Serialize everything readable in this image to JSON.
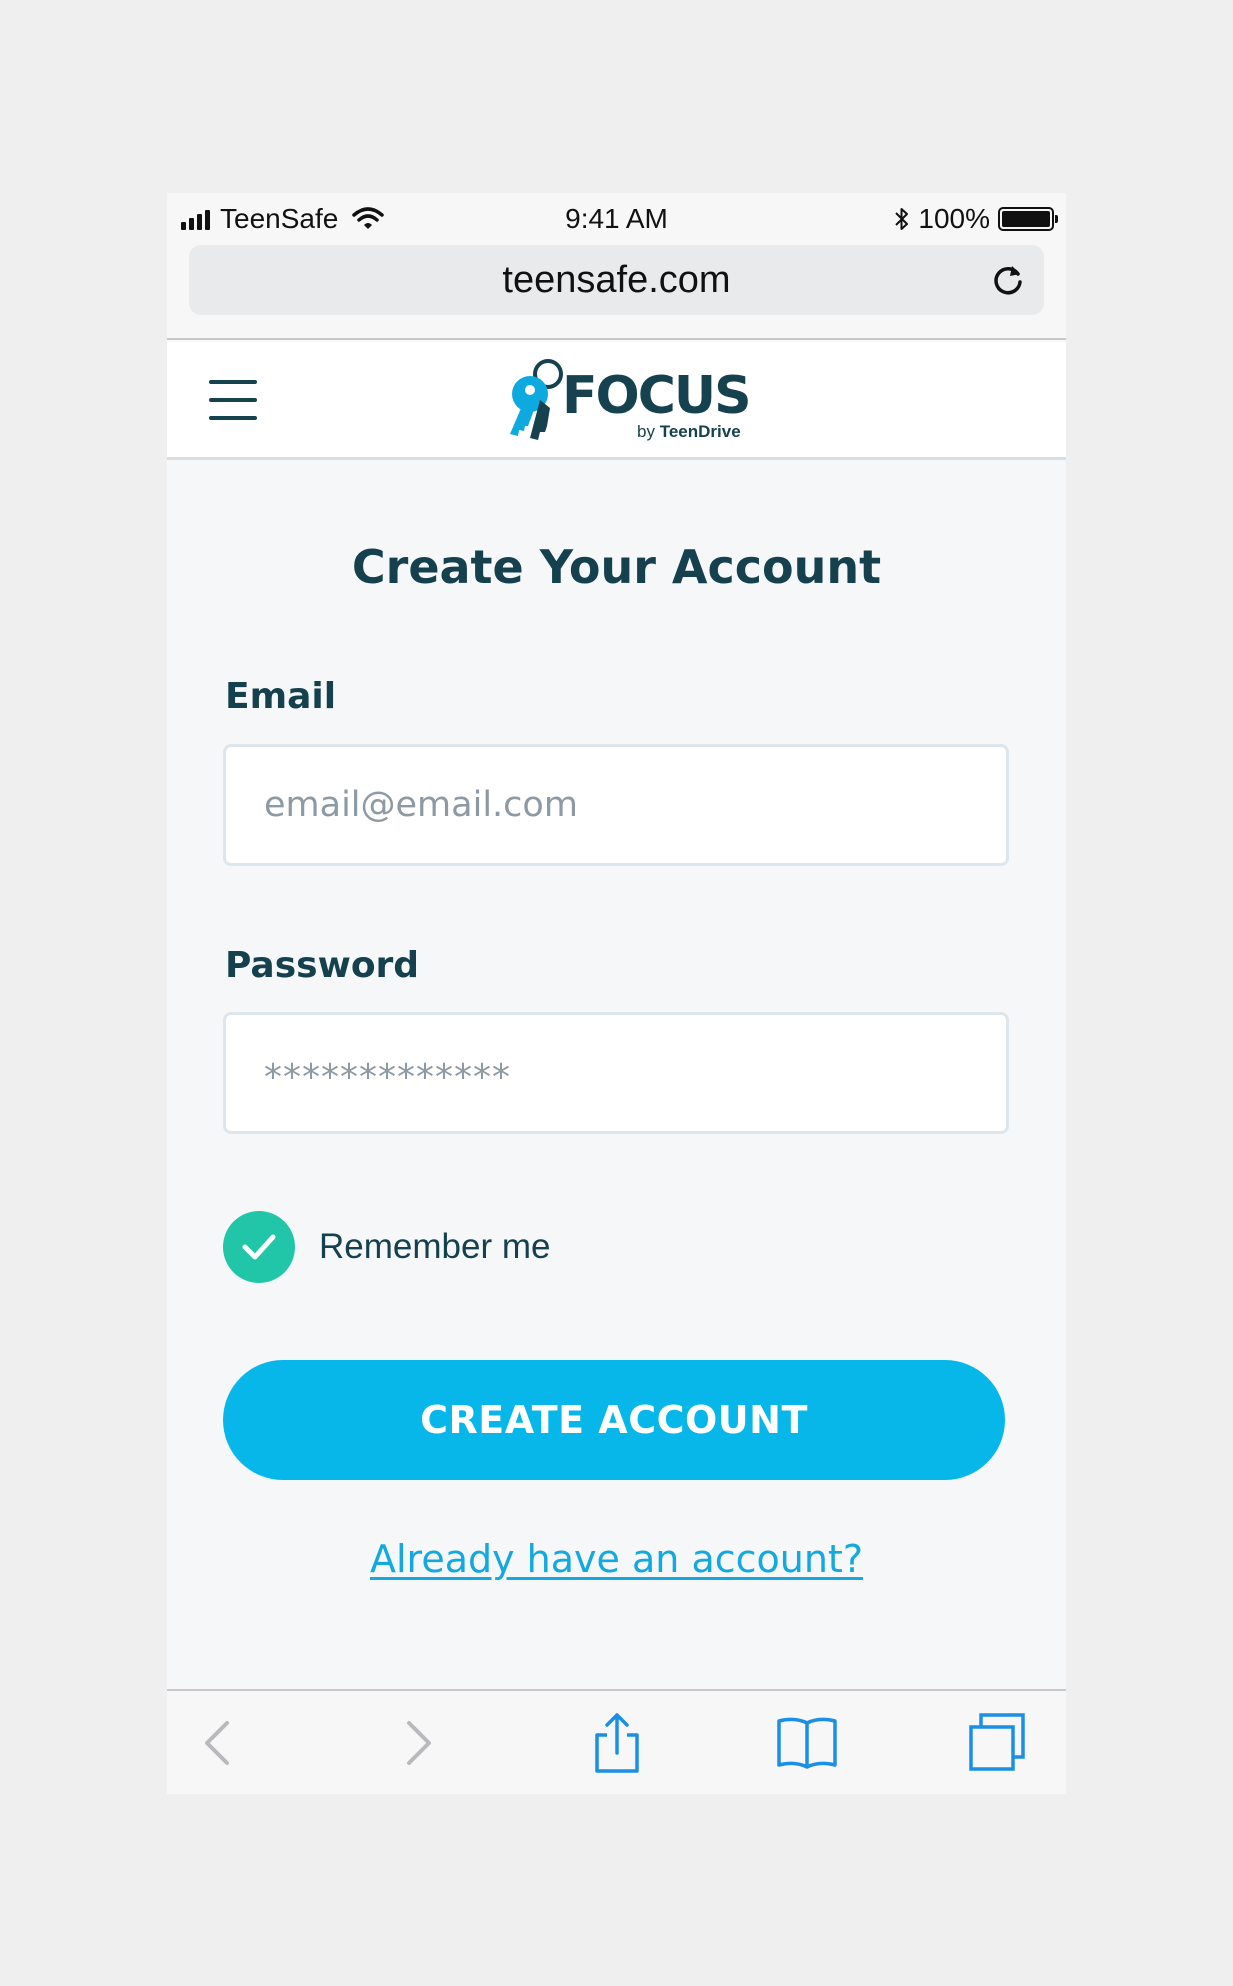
{
  "status_bar": {
    "carrier": "TeenSafe",
    "time": "9:41 AM",
    "battery": "100%",
    "battery_level": 1.0
  },
  "browser": {
    "url": "teensafe.com"
  },
  "header": {
    "logo_word": "FOCUS",
    "logo_by": "by",
    "logo_brand": "TeenDrive"
  },
  "form": {
    "title": "Create Your Account",
    "email_label": "Email",
    "email_placeholder": "email@email.com",
    "password_label": "Password",
    "password_value": "*************",
    "remember_label": "Remember me",
    "remember_checked": true,
    "submit_label": "CREATE ACCOUNT",
    "signin_link": "Already have an account?"
  },
  "colors": {
    "primary": "#08b7ea",
    "heading": "#15404d",
    "check": "#20c6a7",
    "link": "#13a9e0",
    "toolbar_icon": "#1a8fe3",
    "toolbar_disabled": "#b8b8bd"
  },
  "toolbar_icons": [
    "back-icon",
    "forward-icon",
    "share-icon",
    "bookmarks-icon",
    "tabs-icon"
  ]
}
